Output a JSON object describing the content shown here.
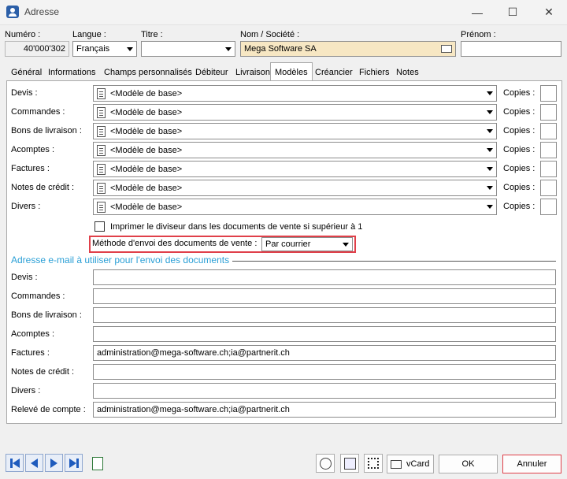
{
  "window": {
    "title": "Adresse",
    "controls": {
      "minimize": "—",
      "maximize": "☐",
      "close": "✕"
    }
  },
  "header": {
    "numero": {
      "label": "Numéro :",
      "value": "40'000'302"
    },
    "langue": {
      "label": "Langue :",
      "value": "Français"
    },
    "titre": {
      "label": "Titre :",
      "value": ""
    },
    "nom": {
      "label": "Nom / Société :",
      "value": "Mega Software SA"
    },
    "prenom": {
      "label": "Prénom :",
      "value": ""
    }
  },
  "tabs": [
    {
      "label": "Général"
    },
    {
      "label": "Informations"
    },
    {
      "label": "Champs personnalisés"
    },
    {
      "label": "Débiteur"
    },
    {
      "label": "Livraison"
    },
    {
      "label": "Modèles"
    },
    {
      "label": "Créancier"
    },
    {
      "label": "Fichiers"
    },
    {
      "label": "Notes"
    }
  ],
  "active_tab": "Modèles",
  "templates": {
    "copies_label": "Copies :",
    "rows": [
      {
        "label": "Devis :",
        "value": "<Modèle de base>"
      },
      {
        "label": "Commandes :",
        "value": "<Modèle de base>"
      },
      {
        "label": "Bons de livraison :",
        "value": "<Modèle de base>"
      },
      {
        "label": "Acomptes :",
        "value": "<Modèle de base>"
      },
      {
        "label": "Factures :",
        "value": "<Modèle de base>"
      },
      {
        "label": "Notes de crédit :",
        "value": "<Modèle de base>"
      },
      {
        "label": "Divers :",
        "value": "<Modèle de base>"
      }
    ],
    "print_divisor": {
      "label": "Imprimer le diviseur dans les documents de vente si supérieur à 1",
      "checked": false
    },
    "send_method": {
      "label": "Méthode d'envoi des documents de vente :",
      "value": "Par courrier"
    }
  },
  "emails": {
    "section_title": "Adresse e-mail à utiliser pour l'envoi des documents",
    "rows": [
      {
        "label": "Devis :",
        "value": ""
      },
      {
        "label": "Commandes :",
        "value": ""
      },
      {
        "label": "Bons de livraison :",
        "value": ""
      },
      {
        "label": "Acomptes :",
        "value": ""
      },
      {
        "label": "Factures :",
        "value": "administration@mega-software.ch;ia@partnerit.ch"
      },
      {
        "label": "Notes de crédit :",
        "value": ""
      },
      {
        "label": "Divers :",
        "value": ""
      },
      {
        "label": "Relevé de compte :",
        "value": "administration@mega-software.ch;ia@partnerit.ch"
      }
    ]
  },
  "footer": {
    "vcard_label": "vCard",
    "ok_label": "OK",
    "cancel_label": "Annuler",
    "accent_color": "#e0404a",
    "nav_color": "#1e5bbd"
  }
}
